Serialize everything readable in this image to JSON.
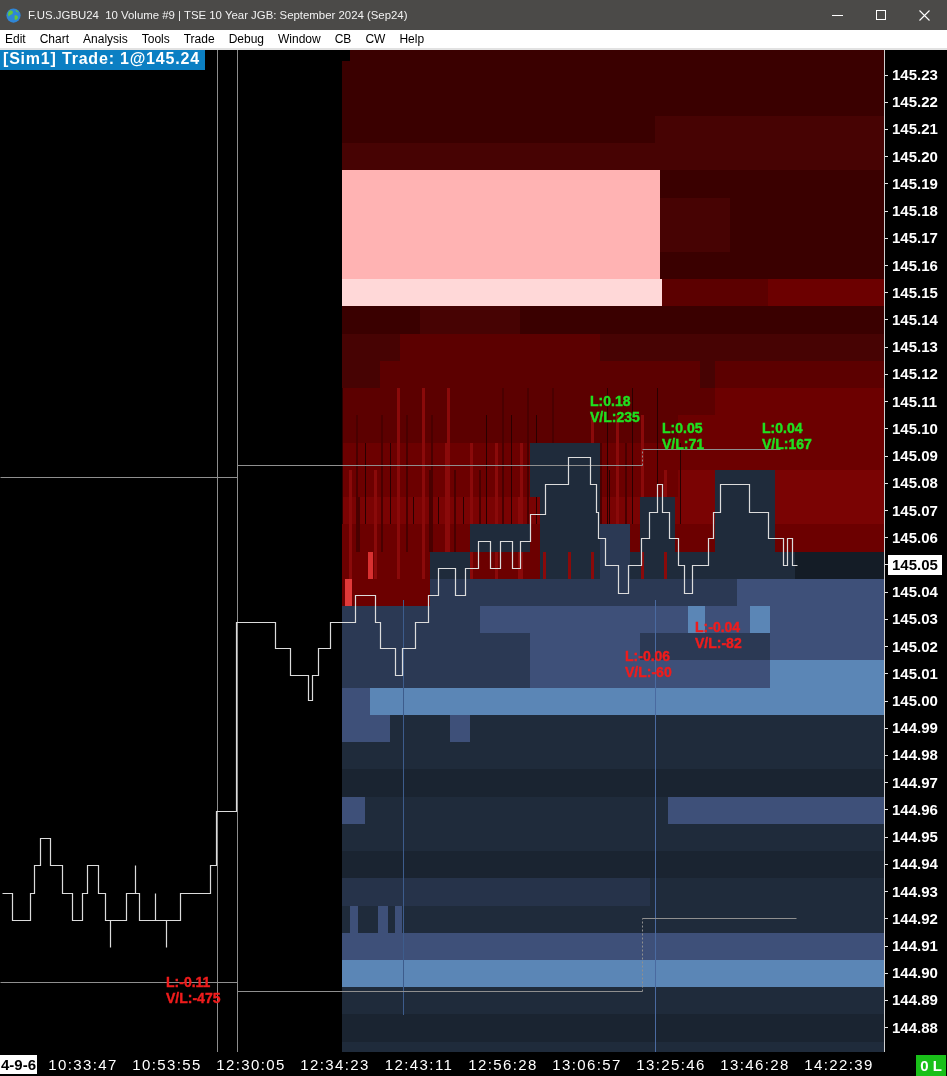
{
  "window": {
    "title": "F.US.JGBU24  10 Volume #9 | TSE 10 Year JGB: September 2024 (Sep24)"
  },
  "menu": [
    "Edit",
    "Chart",
    "Analysis",
    "Tools",
    "Trade",
    "Debug",
    "Window",
    "CB",
    "CW",
    "Help"
  ],
  "chart": {
    "trade_badge": "[Sim1] Trade: 1@145.24",
    "annotations": [
      {
        "l": "L:0.18",
        "vl": "V/L:235",
        "color": "#20e020"
      },
      {
        "l": "L:0.05",
        "vl": "V/L:71",
        "color": "#20e020"
      },
      {
        "l": "L:0.04",
        "vl": "V/L:167",
        "color": "#20e020"
      },
      {
        "l": "L:-0.04",
        "vl": "V/L:-82",
        "color": "#f01c1c"
      },
      {
        "l": "L:-0.06",
        "vl": "V/L:-60",
        "color": "#f01c1c"
      },
      {
        "l": "L:-0.11",
        "vl": "V/L:-475",
        "color": "#f01c1c"
      }
    ],
    "price_axis": [
      {
        "label": "145.23",
        "current": false
      },
      {
        "label": "145.22",
        "current": false
      },
      {
        "label": "145.21",
        "current": false
      },
      {
        "label": "145.20",
        "current": false
      },
      {
        "label": "145.19",
        "current": false
      },
      {
        "label": "145.18",
        "current": false
      },
      {
        "label": "145.17",
        "current": false
      },
      {
        "label": "145.16",
        "current": false
      },
      {
        "label": "145.15",
        "current": false
      },
      {
        "label": "145.14",
        "current": false
      },
      {
        "label": "145.13",
        "current": false
      },
      {
        "label": "145.12",
        "current": false
      },
      {
        "label": "145.11",
        "current": false
      },
      {
        "label": "145.10",
        "current": false
      },
      {
        "label": "145.09",
        "current": false
      },
      {
        "label": "145.08",
        "current": false
      },
      {
        "label": "145.07",
        "current": false
      },
      {
        "label": "145.06",
        "current": false
      },
      {
        "label": "145.05",
        "current": true
      },
      {
        "label": "145.04",
        "current": false
      },
      {
        "label": "145.03",
        "current": false
      },
      {
        "label": "145.02",
        "current": false
      },
      {
        "label": "145.01",
        "current": false
      },
      {
        "label": "145.00",
        "current": false
      },
      {
        "label": "144.99",
        "current": false
      },
      {
        "label": "144.98",
        "current": false
      },
      {
        "label": "144.97",
        "current": false
      },
      {
        "label": "144.96",
        "current": false
      },
      {
        "label": "144.95",
        "current": false
      },
      {
        "label": "144.94",
        "current": false
      },
      {
        "label": "144.93",
        "current": false
      },
      {
        "label": "144.92",
        "current": false
      },
      {
        "label": "144.91",
        "current": false
      },
      {
        "label": "144.90",
        "current": false
      },
      {
        "label": "144.89",
        "current": false
      },
      {
        "label": "144.88",
        "current": false
      }
    ]
  },
  "time_axis": {
    "labels": [
      {
        "label": "4-9-6",
        "kind": "date"
      },
      {
        "label": "10:33:47",
        "kind": "time"
      },
      {
        "label": "10:53:55",
        "kind": "time"
      },
      {
        "label": "12:30:05",
        "kind": "time"
      },
      {
        "label": "12:34:23",
        "kind": "time"
      },
      {
        "label": "12:43:11",
        "kind": "time"
      },
      {
        "label": "12:56:28",
        "kind": "time"
      },
      {
        "label": "13:06:57",
        "kind": "time"
      },
      {
        "label": "13:25:46",
        "kind": "time"
      },
      {
        "label": "13:46:28",
        "kind": "time"
      },
      {
        "label": "14:22:39",
        "kind": "time"
      }
    ],
    "position": "0 L"
  }
}
